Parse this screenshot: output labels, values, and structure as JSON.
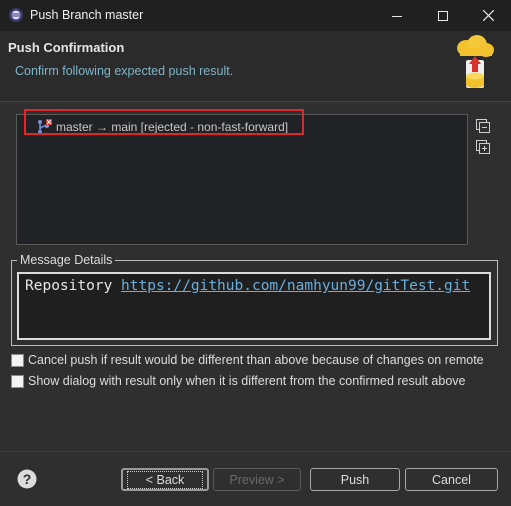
{
  "window": {
    "title": "Push Branch master",
    "minimize": "—",
    "maximize": "☐",
    "close": "✕"
  },
  "header": {
    "title": "Push Confirmation",
    "subtitle": "Confirm following expected push result."
  },
  "results": [
    {
      "text": "master → main [rejected - non-fast-forward]",
      "status_color": "#e0262b"
    }
  ],
  "message_details": {
    "label": "Message Details",
    "prefix": "Repository ",
    "url": "https://github.com/namhyun99/gitTest.git"
  },
  "options": [
    {
      "label": "Cancel push if result would be different than above because of changes on remote",
      "checked": false
    },
    {
      "label": "Show dialog with result only when it is different from the confirmed result above",
      "checked": false
    }
  ],
  "buttons": {
    "back": "< Back",
    "preview": "Preview >",
    "push": "Push",
    "cancel": "Cancel"
  },
  "colors": {
    "accent_link": "#6aaedc",
    "highlight_border": "#e0262b",
    "subtitle": "#7fb4c8"
  }
}
